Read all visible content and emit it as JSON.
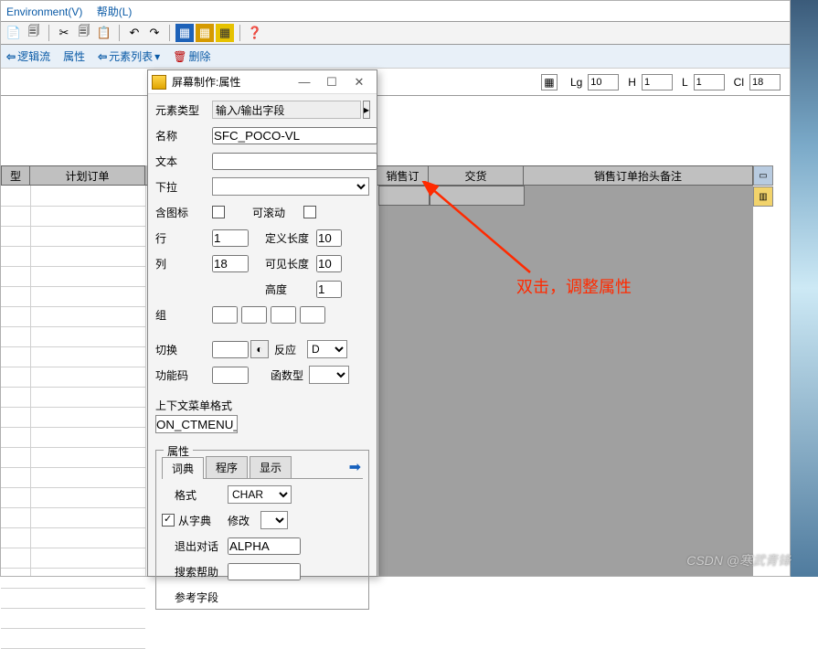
{
  "menubar": {
    "env": "Environment(V)",
    "help": "帮助(L)"
  },
  "subbar": {
    "logic": "逻辑流",
    "attr": "属性",
    "elemlist": "元素列表",
    "remove": "删除"
  },
  "infobar": {
    "lg_label": "Lg",
    "lg": "10",
    "h_label": "H",
    "h": "1",
    "l_label": "L",
    "l": "1",
    "cl_label": "Cl",
    "cl": "18"
  },
  "grid": {
    "headers_left": [
      "型",
      "计划订单"
    ],
    "headers_right_1": "销售订",
    "headers_right_2": "交货",
    "headers_right_3": "销售订单抬头备注"
  },
  "annotation": "双击，调整属性",
  "watermark": "CSDN @寒武青锋",
  "dialog": {
    "title": "屏幕制作:属性",
    "elem_type_label": "元素类型",
    "elem_type": "输入/输出字段",
    "name_label": "名称",
    "name": "SFC_POCO-VL",
    "text_label": "文本",
    "text": "",
    "dropdown_label": "下拉",
    "dropdown": "",
    "has_icon_label": "含图标",
    "scrollable_label": "可滚动",
    "row_label": "行",
    "row": "1",
    "deflen_label": "定义长度",
    "deflen": "10",
    "col_label": "列",
    "col": "18",
    "vislen_label": "可见长度",
    "vislen": "10",
    "height_label": "高度",
    "height": "1",
    "group_label": "组",
    "group1": "",
    "group2": "",
    "group3": "",
    "group4": "",
    "switch_label": "切换",
    "switch": "",
    "react_label": "反应",
    "react": "D",
    "fcode_label": "功能码",
    "fcode": "",
    "ftype_label": "函数型",
    "ftype": "",
    "ctxmenu_label": "上下文菜单格式",
    "ctxmenu": "ON_CTMENU_",
    "props_label": "属性",
    "tab_dict": "词典",
    "tab_prog": "程序",
    "tab_disp": "显示",
    "fmt_label": "格式",
    "fmt": "CHAR",
    "fromdict_label": "从字典",
    "modify_label": "修改",
    "exit_label": "退出对话",
    "exit": "ALPHA",
    "search_label": "搜索帮助",
    "search": "",
    "reffield_label": "参考字段"
  }
}
